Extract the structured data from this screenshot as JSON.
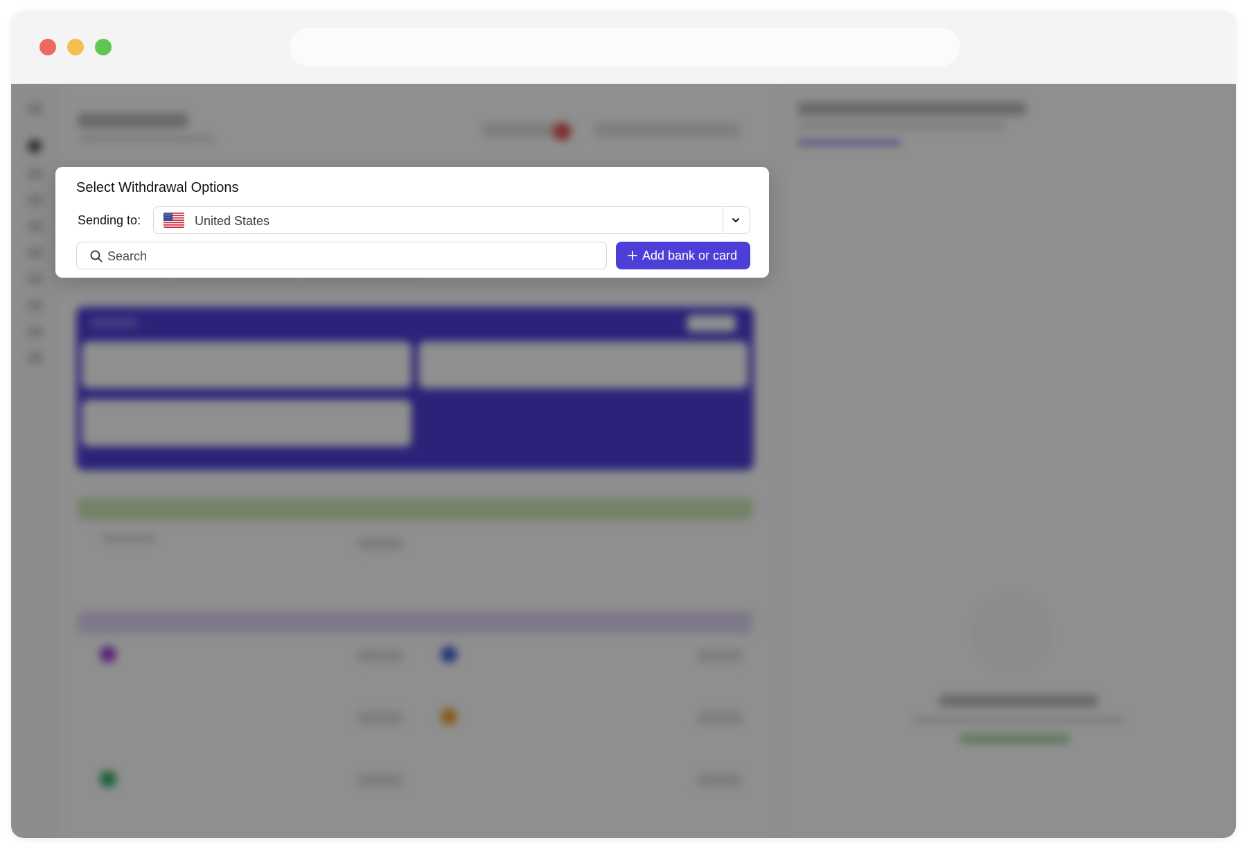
{
  "modal": {
    "title": "Select Withdrawal Options",
    "sending_label": "Sending to:",
    "country": {
      "selected": "United States",
      "flag_icon": "us-flag-icon"
    },
    "search": {
      "placeholder": "Search",
      "value": ""
    },
    "add_button_label": "Add bank or card"
  },
  "colors": {
    "accent": "#4c3fd8",
    "overlay": "rgba(0,0,0,0.44)",
    "traffic_red": "#ed6a5e",
    "traffic_yellow": "#f5bf4f",
    "traffic_green": "#61c554"
  }
}
